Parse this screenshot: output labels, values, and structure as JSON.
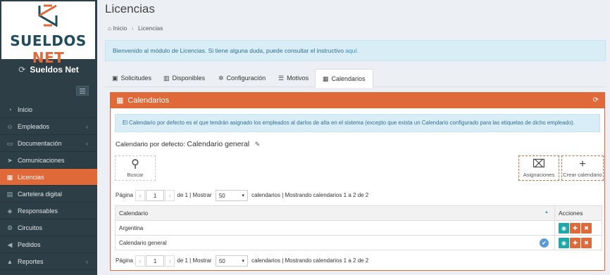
{
  "brand": {
    "logo_text_1": "SUELDOS",
    "logo_text_2": "NET",
    "name": "Sueldos Net"
  },
  "sidebar": {
    "items": [
      {
        "label": "Inicio",
        "icon": "dashboard-icon",
        "caret": false
      },
      {
        "label": "Empleados",
        "icon": "users-icon",
        "caret": true
      },
      {
        "label": "Documentación",
        "icon": "folder-icon",
        "caret": true
      },
      {
        "label": "Comunicaciones",
        "icon": "paper-plane-icon",
        "caret": false
      },
      {
        "label": "Licencias",
        "icon": "calendar-icon",
        "caret": false,
        "active": true
      },
      {
        "label": "Cartelera digital",
        "icon": "board-icon",
        "caret": false
      },
      {
        "label": "Responsables",
        "icon": "shield-icon",
        "caret": false
      },
      {
        "label": "Circuitos",
        "icon": "circuit-icon",
        "caret": false
      },
      {
        "label": "Pedidos",
        "icon": "megaphone-icon",
        "caret": false
      },
      {
        "label": "Reportes",
        "icon": "chart-icon",
        "caret": true
      }
    ]
  },
  "header": {
    "title": "Licencias",
    "breadcrumb_home": "Inicio",
    "breadcrumb_current": "Licencias"
  },
  "info_top": {
    "text": "Bienvenido al módulo de Licencias. Si tiene alguna duda, puede consultar el instructivo ",
    "link": "aquí."
  },
  "tabs": [
    {
      "label": "Solicitudes",
      "icon": "inbox-icon"
    },
    {
      "label": "Disponibles",
      "icon": "bar-chart-icon"
    },
    {
      "label": "Configuración",
      "icon": "cog-icon"
    },
    {
      "label": "Motivos",
      "icon": "list-icon"
    },
    {
      "label": "Calendarios",
      "icon": "calendar-icon",
      "active": true
    }
  ],
  "panel": {
    "title": "Calendarios",
    "info": "El Calendario por defecto es el que tendrán asignado los empleados al darlos de alta en el sistema (excepto que exista un Calendario configurado para las etiquetas de dicho empleado).",
    "default_label": "Calendario por defecto:",
    "default_value": "Calendario general",
    "buttons": {
      "search": "Buscar",
      "assignments": "Asignaciones",
      "create": "Crear calendario"
    },
    "pager": {
      "page_label": "Página",
      "page_value": "1",
      "of_text": "de 1 | Mostrar",
      "per_page": "50",
      "summary": "calendarios | Mostrando calendarios 1 a 2 de 2"
    },
    "table": {
      "col_calendar": "Calendario",
      "col_actions": "Acciones",
      "rows": [
        {
          "name": "Argentina",
          "is_default": false
        },
        {
          "name": "Calendario general",
          "is_default": true
        }
      ]
    }
  }
}
